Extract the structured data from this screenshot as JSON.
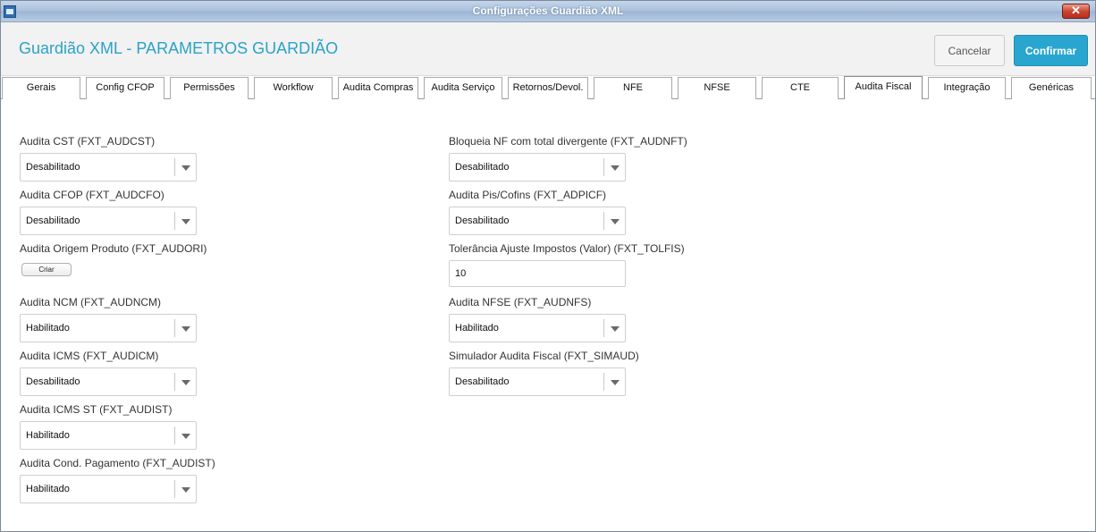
{
  "window": {
    "title": "Configurações Guardião XML",
    "close_glyph": "✕"
  },
  "header": {
    "title": "Guardião XML - PARAMETROS GUARDIÃO",
    "cancel_label": "Cancelar",
    "confirm_label": "Confirmar"
  },
  "tabs": [
    {
      "label": "Gerais"
    },
    {
      "label": "Config CFOP"
    },
    {
      "label": "Permissões"
    },
    {
      "label": "Workflow"
    },
    {
      "label": "Audita Compras"
    },
    {
      "label": "Audita Serviço"
    },
    {
      "label": "Retornos/Devol."
    },
    {
      "label": "NFE"
    },
    {
      "label": "NFSE"
    },
    {
      "label": "CTE"
    },
    {
      "label": "Audita Fiscal",
      "active": true
    },
    {
      "label": "Integração"
    },
    {
      "label": "Genéricas"
    }
  ],
  "form": {
    "left": {
      "audcst": {
        "label": "Audita CST (FXT_AUDCST)",
        "value": "Desabilitado"
      },
      "audcfo": {
        "label": "Audita CFOP (FXT_AUDCFO)",
        "value": "Desabilitado"
      },
      "audori": {
        "label": "Audita Origem Produto (FXT_AUDORI)",
        "button_label": "Criar"
      },
      "audncm": {
        "label": "Audita NCM (FXT_AUDNCM)",
        "value": "Habilitado"
      },
      "audicm": {
        "label": "Audita ICMS (FXT_AUDICM)",
        "value": "Desabilitado"
      },
      "audist": {
        "label": "Audita ICMS ST (FXT_AUDIST)",
        "value": "Habilitado"
      },
      "audpag": {
        "label": "Audita Cond. Pagamento (FXT_AUDIST)",
        "value": "Habilitado"
      }
    },
    "right": {
      "audnft": {
        "label": "Bloqueia NF com total divergente (FXT_AUDNFT)",
        "value": "Desabilitado"
      },
      "adpicf": {
        "label": "Audita Pis/Cofins (FXT_ADPICF)",
        "value": "Desabilitado"
      },
      "tolfis": {
        "label": "Tolerância Ajuste Impostos (Valor) (FXT_TOLFIS)",
        "value": "10"
      },
      "audnfs": {
        "label": "Audita NFSE (FXT_AUDNFS)",
        "value": "Habilitado"
      },
      "simaud": {
        "label": "Simulador Audita Fiscal (FXT_SIMAUD)",
        "value": "Desabilitado"
      }
    }
  }
}
